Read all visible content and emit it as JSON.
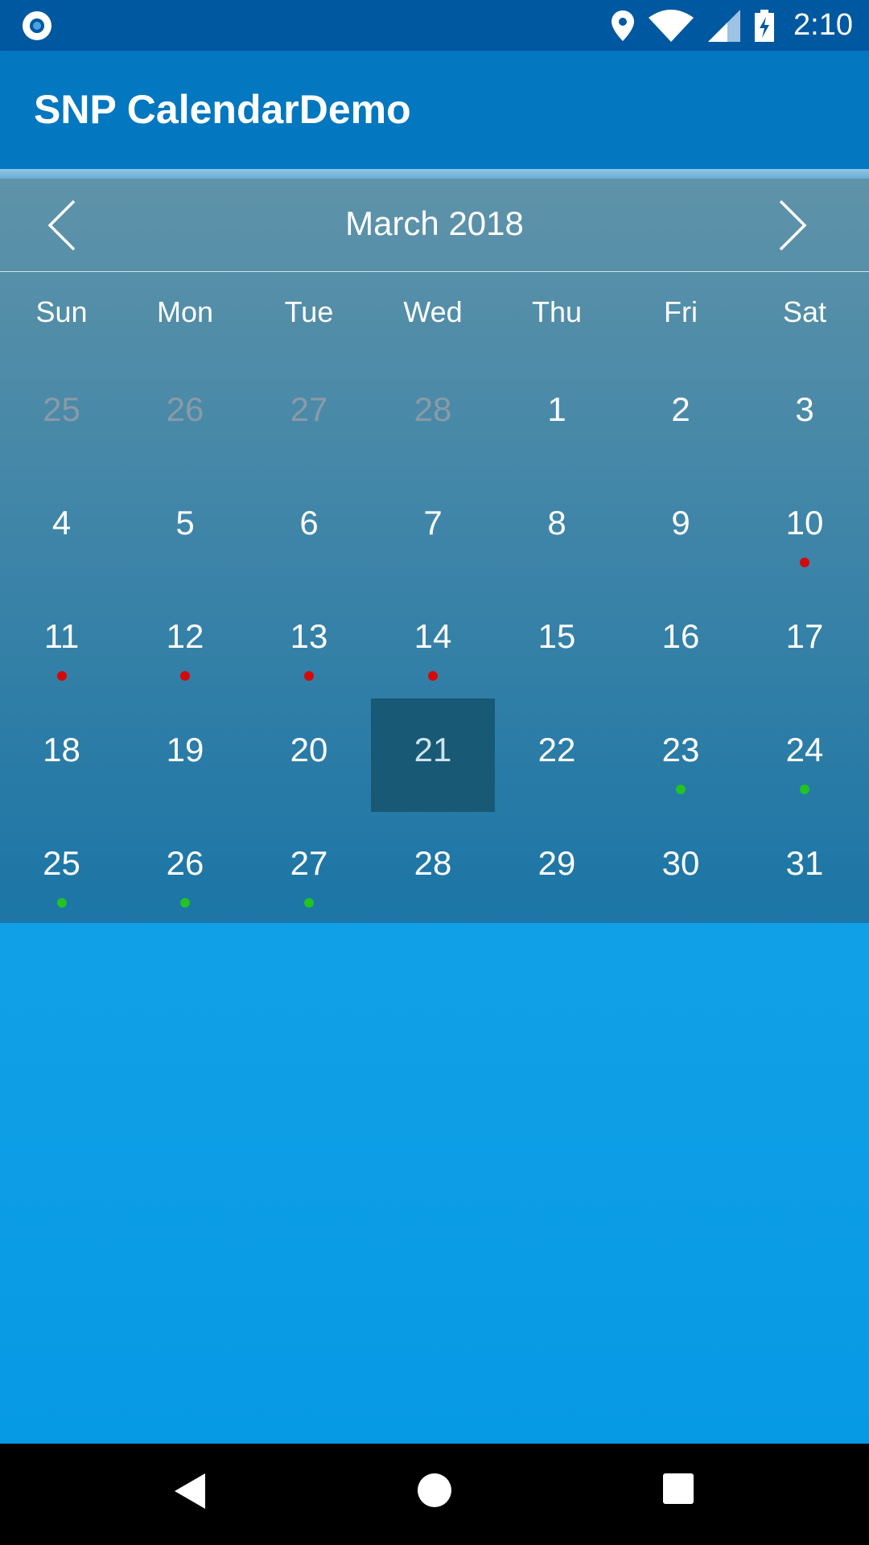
{
  "status_bar": {
    "time": "2:10",
    "icons": [
      "app-notification-icon",
      "location-icon",
      "wifi-icon",
      "signal-icon",
      "battery-charging-icon"
    ]
  },
  "app_bar": {
    "title": "SNP CalendarDemo"
  },
  "calendar": {
    "month_title": "March 2018",
    "prev_icon": "chevron-left-icon",
    "next_icon": "chevron-right-icon",
    "weekdays": [
      "Sun",
      "Mon",
      "Tue",
      "Wed",
      "Thu",
      "Fri",
      "Sat"
    ],
    "weeks": [
      [
        {
          "day": "25",
          "muted": true
        },
        {
          "day": "26",
          "muted": true
        },
        {
          "day": "27",
          "muted": true
        },
        {
          "day": "28",
          "muted": true
        },
        {
          "day": "1"
        },
        {
          "day": "2"
        },
        {
          "day": "3"
        }
      ],
      [
        {
          "day": "4"
        },
        {
          "day": "5"
        },
        {
          "day": "6"
        },
        {
          "day": "7"
        },
        {
          "day": "8"
        },
        {
          "day": "9"
        },
        {
          "day": "10",
          "dot": "red"
        }
      ],
      [
        {
          "day": "11",
          "dot": "red"
        },
        {
          "day": "12",
          "dot": "red"
        },
        {
          "day": "13",
          "dot": "red"
        },
        {
          "day": "14",
          "dot": "red"
        },
        {
          "day": "15"
        },
        {
          "day": "16"
        },
        {
          "day": "17"
        }
      ],
      [
        {
          "day": "18"
        },
        {
          "day": "19"
        },
        {
          "day": "20"
        },
        {
          "day": "21",
          "selected": true
        },
        {
          "day": "22"
        },
        {
          "day": "23",
          "dot": "green"
        },
        {
          "day": "24",
          "dot": "green"
        }
      ],
      [
        {
          "day": "25",
          "dot": "green"
        },
        {
          "day": "26",
          "dot": "green"
        },
        {
          "day": "27",
          "dot": "green"
        },
        {
          "day": "28"
        },
        {
          "day": "29"
        },
        {
          "day": "30"
        },
        {
          "day": "31"
        }
      ]
    ],
    "colors": {
      "selected_bg": "#185975",
      "event_red": "#d40a0a",
      "event_green": "#22c322"
    }
  },
  "nav_bar": {
    "icons": [
      "back-icon",
      "home-icon",
      "recents-icon"
    ]
  }
}
